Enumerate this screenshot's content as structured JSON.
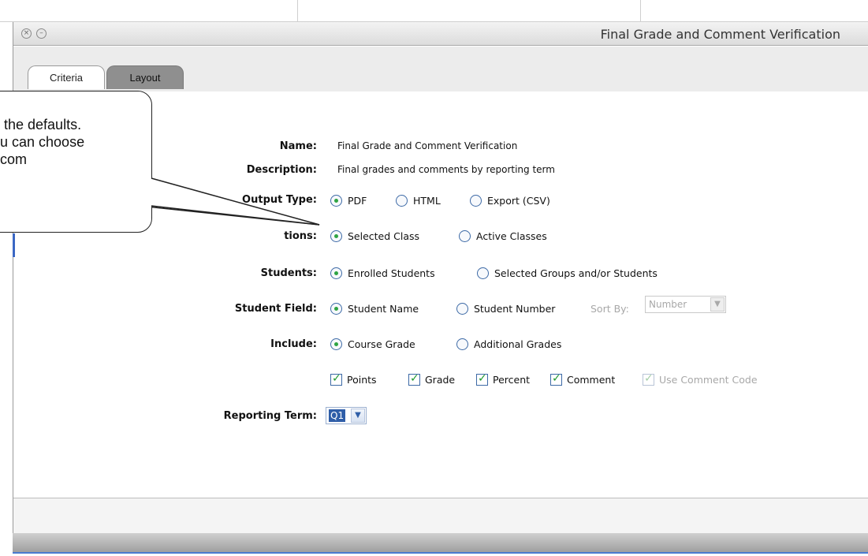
{
  "window": {
    "title": "Final Grade and Comment Verification"
  },
  "tabs": [
    {
      "label": "Criteria",
      "active": true
    },
    {
      "label": "Layout",
      "active": false
    }
  ],
  "form": {
    "name_label": "Name:",
    "name_value": "Final Grade and Comment Verification",
    "description_label": "Description:",
    "description_value": "Final grades and comments by reporting term",
    "output_type_label": "Output Type:",
    "output_type_options": [
      "PDF",
      "HTML",
      "Export (CSV)"
    ],
    "output_type_selected": "PDF",
    "sections_label_visible": "tions:",
    "sections_options": [
      "Selected Class",
      "Active Classes"
    ],
    "sections_selected": "Selected Class",
    "students_label": "Students:",
    "students_options": [
      "Enrolled Students",
      "Selected Groups and/or Students"
    ],
    "students_selected": "Enrolled Students",
    "student_field_label": "Student Field:",
    "student_field_options": [
      "Student Name",
      "Student Number"
    ],
    "student_field_selected": "Student Name",
    "sort_by_label": "Sort By:",
    "sort_by_value": "Number",
    "include_label": "Include:",
    "include_options": [
      "Course Grade",
      "Additional Grades"
    ],
    "include_selected": "Course Grade",
    "checkboxes": [
      {
        "label": "Points",
        "checked": true
      },
      {
        "label": "Grade",
        "checked": true
      },
      {
        "label": "Percent",
        "checked": true
      },
      {
        "label": "Comment",
        "checked": true
      },
      {
        "label": "Use Comment Code",
        "checked": true,
        "disabled": true
      }
    ],
    "reporting_term_label": "Reporting Term:",
    "reporting_term_value": "Q1"
  },
  "callout": {
    "text": " the defaults.\nu can choose\ncom"
  },
  "colors": {
    "radio_selected": "#2fa443",
    "accent_blue": "#3b67c4",
    "tab_inactive": "#8f8f8f"
  },
  "icons": [
    "close-window-icon",
    "minimize-window-icon",
    "chevron-down-icon",
    "checkmark-icon"
  ]
}
